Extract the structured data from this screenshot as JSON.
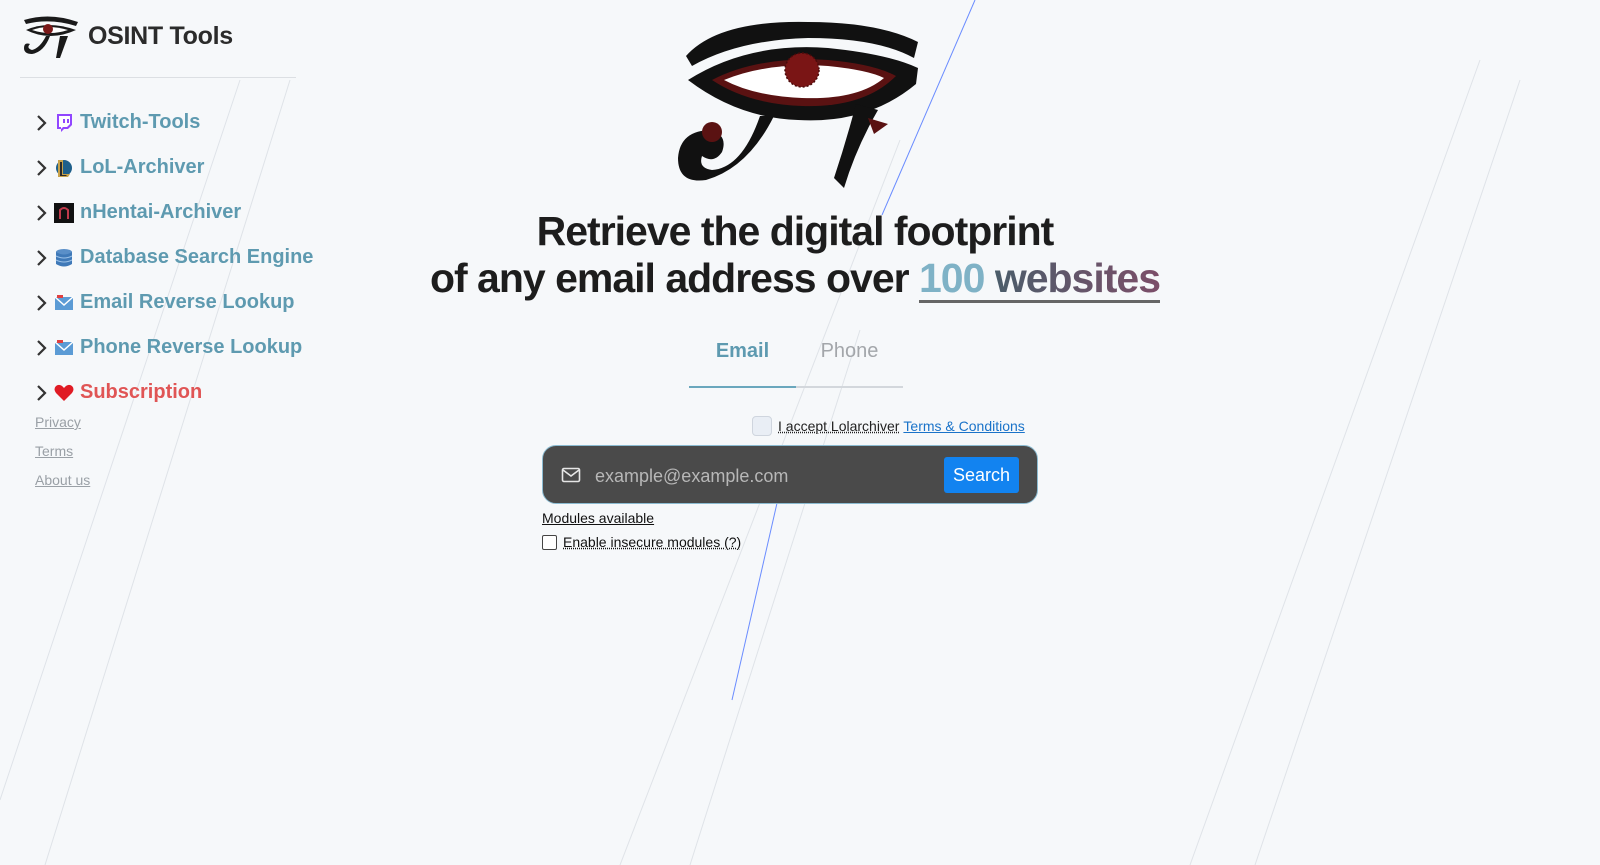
{
  "brand": {
    "name": "OSINT Tools"
  },
  "sidebar": {
    "items": [
      {
        "label": "Twitch-Tools",
        "icon": "twitch-icon"
      },
      {
        "label": "LoL-Archiver",
        "icon": "lol-icon"
      },
      {
        "label": "nHentai-Archiver",
        "icon": "nhentai-icon"
      },
      {
        "label": "Database Search Engine",
        "icon": "database-icon"
      },
      {
        "label": "Email Reverse Lookup",
        "icon": "envelope-icon"
      },
      {
        "label": "Phone Reverse Lookup",
        "icon": "envelope-icon"
      },
      {
        "label": "Subscription",
        "icon": "heart-icon"
      }
    ],
    "footer_links": [
      "Privacy",
      "Terms",
      "About us"
    ]
  },
  "hero": {
    "line1": "Retrieve the digital footprint",
    "line2_prefix": "of any email address over ",
    "accent_number": "100",
    "accent_word": "websites"
  },
  "tabs": [
    {
      "label": "Email",
      "active": true
    },
    {
      "label": "Phone",
      "active": false
    }
  ],
  "terms": {
    "text": "I accept Lolarchiver",
    "link": "Terms & Conditions",
    "checked": false
  },
  "search": {
    "placeholder": "example@example.com",
    "value": "",
    "button_label": "Search"
  },
  "modules_link": "Modules available",
  "insecure": {
    "label": "Enable insecure modules (?)",
    "checked": false
  },
  "colors": {
    "accent": "#5e9ab0",
    "subscription": "#e05555",
    "search_button": "#1283f0",
    "search_bar": "#4a4a4a"
  }
}
